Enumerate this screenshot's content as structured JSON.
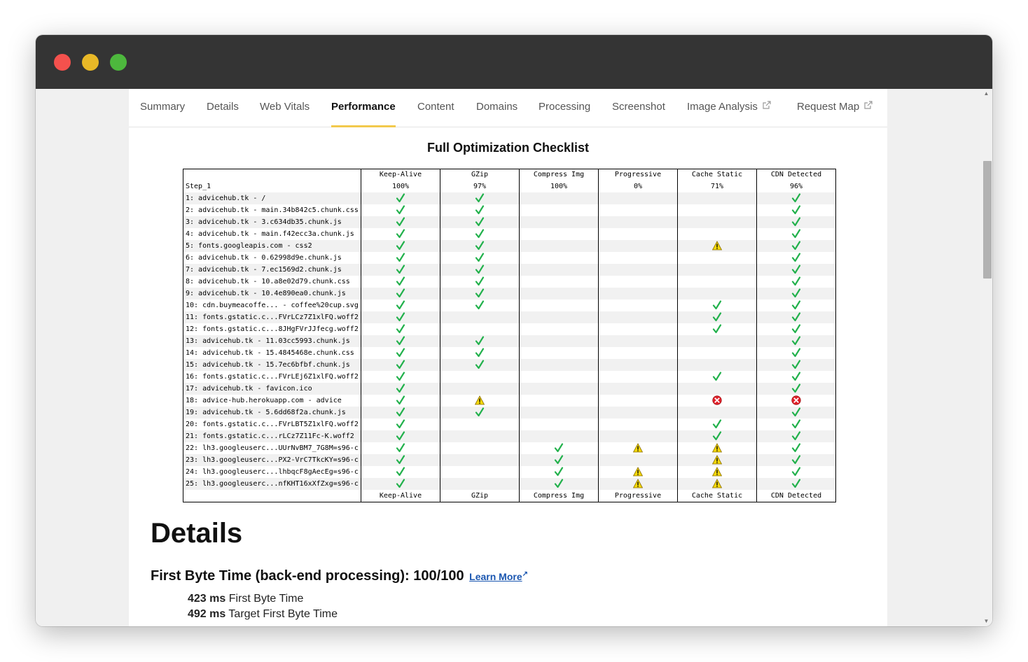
{
  "tabs": [
    {
      "label": "Summary"
    },
    {
      "label": "Details"
    },
    {
      "label": "Web Vitals"
    },
    {
      "label": "Performance",
      "active": true
    },
    {
      "label": "Content"
    },
    {
      "label": "Domains"
    },
    {
      "label": "Processing"
    },
    {
      "label": "Screenshot"
    },
    {
      "label": "Image Analysis",
      "external": true
    },
    {
      "label": "Request Map",
      "external": true
    }
  ],
  "checklist": {
    "title": "Full Optimization Checklist",
    "step_label": "Step_1",
    "columns": [
      {
        "name": "Keep-Alive",
        "score": "100%"
      },
      {
        "name": "GZip",
        "score": "97%"
      },
      {
        "name": "Compress Img",
        "score": "100%"
      },
      {
        "name": "Progressive",
        "score": "0%"
      },
      {
        "name": "Cache Static",
        "score": "71%"
      },
      {
        "name": "CDN Detected",
        "score": "96%"
      }
    ],
    "rows": [
      {
        "label": "1: advicehub.tk - /",
        "marks": [
          "pass",
          "pass",
          "",
          "",
          "",
          "pass"
        ]
      },
      {
        "label": "2: advicehub.tk - main.34b842c5.chunk.css",
        "marks": [
          "pass",
          "pass",
          "",
          "",
          "",
          "pass"
        ]
      },
      {
        "label": "3: advicehub.tk - 3.c634db35.chunk.js",
        "marks": [
          "pass",
          "pass",
          "",
          "",
          "",
          "pass"
        ]
      },
      {
        "label": "4: advicehub.tk - main.f42ecc3a.chunk.js",
        "marks": [
          "pass",
          "pass",
          "",
          "",
          "",
          "pass"
        ]
      },
      {
        "label": "5: fonts.googleapis.com - css2",
        "marks": [
          "pass",
          "pass",
          "",
          "",
          "warn",
          "pass"
        ]
      },
      {
        "label": "6: advicehub.tk - 0.62998d9e.chunk.js",
        "marks": [
          "pass",
          "pass",
          "",
          "",
          "",
          "pass"
        ]
      },
      {
        "label": "7: advicehub.tk - 7.ec1569d2.chunk.js",
        "marks": [
          "pass",
          "pass",
          "",
          "",
          "",
          "pass"
        ]
      },
      {
        "label": "8: advicehub.tk - 10.a8e02d79.chunk.css",
        "marks": [
          "pass",
          "pass",
          "",
          "",
          "",
          "pass"
        ]
      },
      {
        "label": "9: advicehub.tk - 10.4e890ea0.chunk.js",
        "marks": [
          "pass",
          "pass",
          "",
          "",
          "",
          "pass"
        ]
      },
      {
        "label": "10: cdn.buymeacoffe... - coffee%20cup.svg",
        "marks": [
          "pass",
          "pass",
          "",
          "",
          "pass",
          "pass"
        ]
      },
      {
        "label": "11: fonts.gstatic.c...FVrLCz7Z1xlFQ.woff2",
        "marks": [
          "pass",
          "",
          "",
          "",
          "pass",
          "pass"
        ]
      },
      {
        "label": "12: fonts.gstatic.c...8JHgFVrJJfecg.woff2",
        "marks": [
          "pass",
          "",
          "",
          "",
          "pass",
          "pass"
        ]
      },
      {
        "label": "13: advicehub.tk - 11.03cc5993.chunk.js",
        "marks": [
          "pass",
          "pass",
          "",
          "",
          "",
          "pass"
        ]
      },
      {
        "label": "14: advicehub.tk - 15.4845468e.chunk.css",
        "marks": [
          "pass",
          "pass",
          "",
          "",
          "",
          "pass"
        ]
      },
      {
        "label": "15: advicehub.tk - 15.7ec6bfbf.chunk.js",
        "marks": [
          "pass",
          "pass",
          "",
          "",
          "",
          "pass"
        ]
      },
      {
        "label": "16: fonts.gstatic.c...FVrLEj6Z1xlFQ.woff2",
        "marks": [
          "pass",
          "",
          "",
          "",
          "pass",
          "pass"
        ]
      },
      {
        "label": "17: advicehub.tk - favicon.ico",
        "marks": [
          "pass",
          "",
          "",
          "",
          "",
          "pass"
        ]
      },
      {
        "label": "18: advice-hub.herokuapp.com - advice",
        "marks": [
          "pass",
          "warn",
          "",
          "",
          "fail",
          "fail"
        ]
      },
      {
        "label": "19: advicehub.tk - 5.6dd68f2a.chunk.js",
        "marks": [
          "pass",
          "pass",
          "",
          "",
          "",
          "pass"
        ]
      },
      {
        "label": "20: fonts.gstatic.c...FVrLBT5Z1xlFQ.woff2",
        "marks": [
          "pass",
          "",
          "",
          "",
          "pass",
          "pass"
        ]
      },
      {
        "label": "21: fonts.gstatic.c...rLCz7Z11Fc-K.woff2",
        "marks": [
          "pass",
          "",
          "",
          "",
          "pass",
          "pass"
        ]
      },
      {
        "label": "22: lh3.googleuserc...UUrNvBM7_7G8M=s96-c",
        "marks": [
          "pass",
          "",
          "pass",
          "warn",
          "warn",
          "pass"
        ]
      },
      {
        "label": "23: lh3.googleuserc...PX2-VrC7TkcKY=s96-c",
        "marks": [
          "pass",
          "",
          "pass",
          "",
          "warn",
          "pass"
        ]
      },
      {
        "label": "24: lh3.googleuserc...lhbqcF8gAecEg=s96-c",
        "marks": [
          "pass",
          "",
          "pass",
          "warn",
          "warn",
          "pass"
        ]
      },
      {
        "label": "25: lh3.googleuserc...nfKHT16xXfZxg=s96-c",
        "marks": [
          "pass",
          "",
          "pass",
          "warn",
          "warn",
          "pass"
        ]
      }
    ]
  },
  "details": {
    "heading": "Details",
    "first_byte_heading": "First Byte Time (back-end processing): 100/100",
    "learn_more": "Learn More",
    "metrics": [
      {
        "value": "423 ms",
        "label": "First Byte Time"
      },
      {
        "value": "492 ms",
        "label": "Target First Byte Time"
      }
    ]
  },
  "colors": {
    "pass": "#22b14c",
    "warn": "#f5d90a",
    "fail": "#e0202a",
    "active_tab_underline": "#f2c94c",
    "link": "#1a56b0"
  }
}
